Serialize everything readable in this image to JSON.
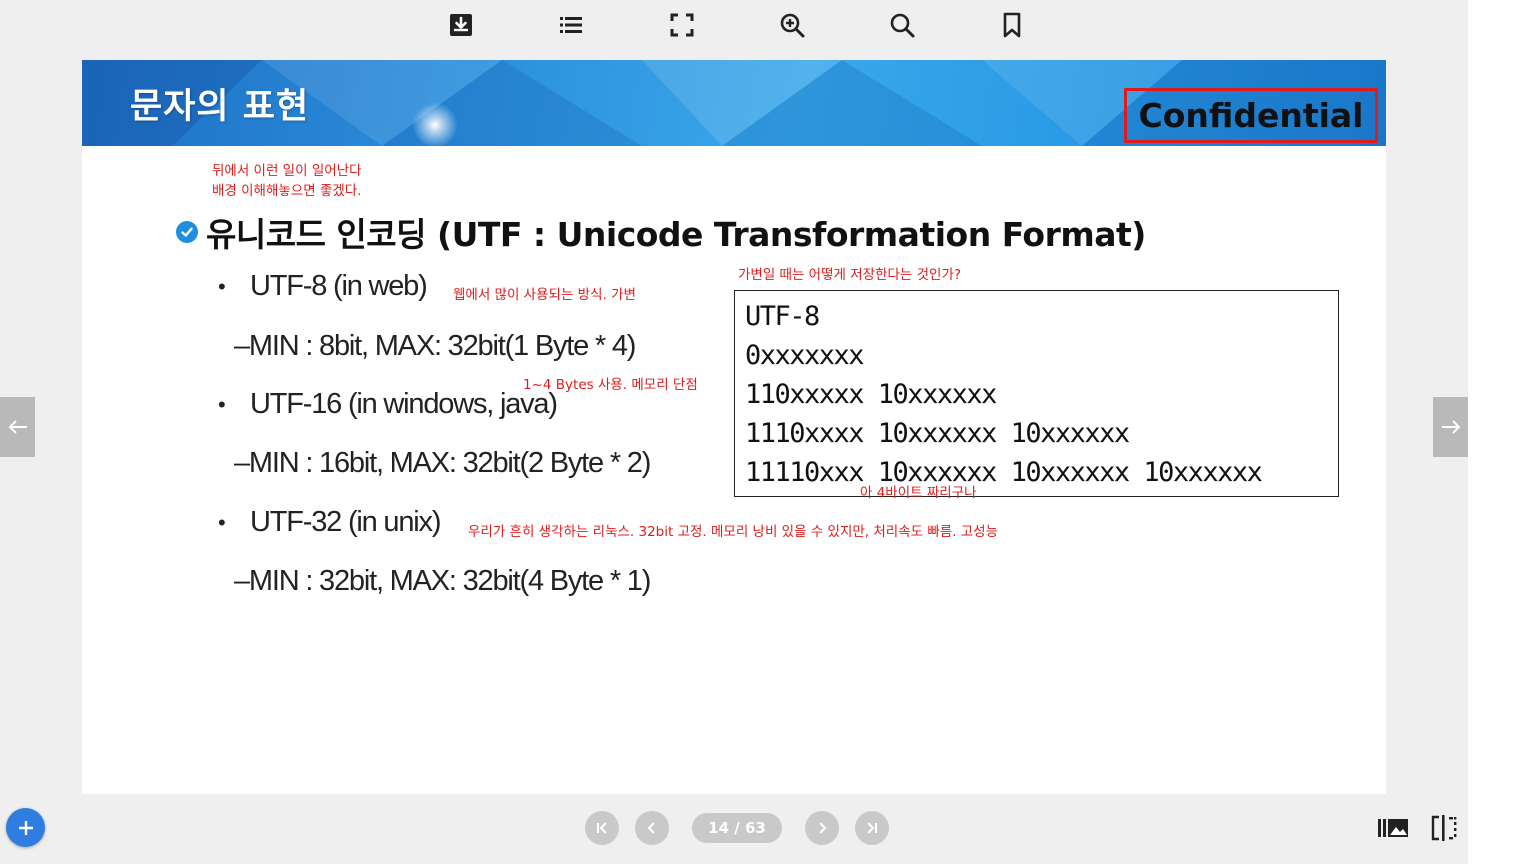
{
  "toolbar": {
    "icons": [
      "download-icon",
      "list-icon",
      "fullscreen-icon",
      "zoom-in-icon",
      "search-icon",
      "bookmark-icon"
    ]
  },
  "slide": {
    "title": "문자의 표현",
    "confidential": "Confidential",
    "annotations": {
      "top_line1": "뒤에서 이런 일이 일어난다",
      "top_line2": "배경 이해해놓으면 좋겠다.",
      "variable_question": "가변일 때는 어떻게 저장한다는 것인가?",
      "utf8_note": "웹에서 많이 사용되는 방식. 가변",
      "utf16_note": "1~4 Bytes 사용. 메모리 단점",
      "four_byte_note": "아 4바이트 짜리구나",
      "utf32_note": "우리가 흔히 생각하는 리눅스. 32bit 고정. 메모리 낭비 있을 수 있지만, 처리속도 빠름. 고성능"
    },
    "heading": "유니코드 인코딩 (UTF : Unicode Transformation Format)",
    "bullets": [
      {
        "label": "UTF-8 (in web)",
        "sub": "–MIN : 8bit, MAX: 32bit(1 Byte * 4)"
      },
      {
        "label": "UTF-16 (in windows,  java)",
        "sub": "–MIN : 16bit, MAX: 32bit(2 Byte * 2)"
      },
      {
        "label": "UTF-32 (in unix)",
        "sub": "–MIN : 32bit, MAX: 32bit(4 Byte * 1)"
      }
    ],
    "code_box": [
      "UTF-8",
      "0xxxxxxx",
      "110xxxxx 10xxxxxx",
      "1110xxxx 10xxxxxx 10xxxxxx",
      "11110xxx 10xxxxxx 10xxxxxx 10xxxxxx"
    ]
  },
  "pagination": {
    "current": "14",
    "total": "63",
    "label": "14 / 63"
  },
  "colors": {
    "annotation": "#e01b1b",
    "header_blue": "#2b8fdc",
    "add_button": "#2f7de1",
    "nav_gray": "#c9c9c9"
  }
}
